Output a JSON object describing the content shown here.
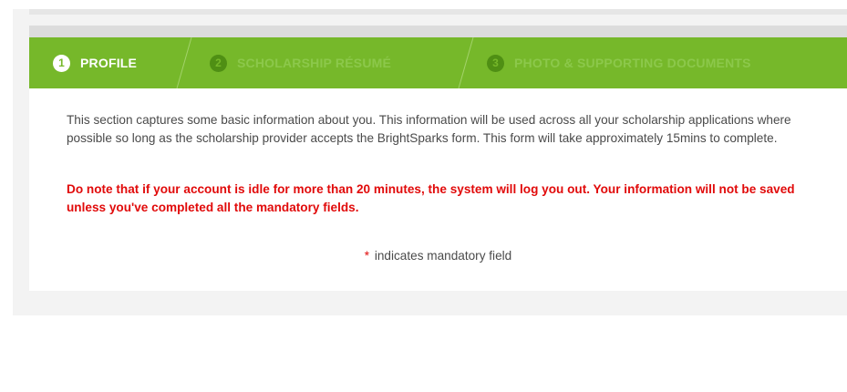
{
  "steps": [
    {
      "number": "1",
      "label": "PROFILE",
      "active": true
    },
    {
      "number": "2",
      "label": "SCHOLARSHIP RÉSUMÉ",
      "active": false
    },
    {
      "number": "3",
      "label": "PHOTO & SUPPORTING DOCUMENTS",
      "active": false
    }
  ],
  "content": {
    "intro": "This section captures some basic information about you. This information will be used across all your scholarship applications where possible so long as the scholarship provider accepts the BrightSparks form. This form will take approximately 15mins to complete.",
    "warning": "Do note that if your account is idle for more than 20 minutes, the system will log you out. Your information will not be saved unless you've completed all the mandatory fields.",
    "mandatory_marker": "*",
    "mandatory_note": "indicates mandatory field"
  },
  "colors": {
    "step_bar": "#76b82a",
    "warning_text": "#e10a0a",
    "body_text": "#4a4a4a"
  }
}
